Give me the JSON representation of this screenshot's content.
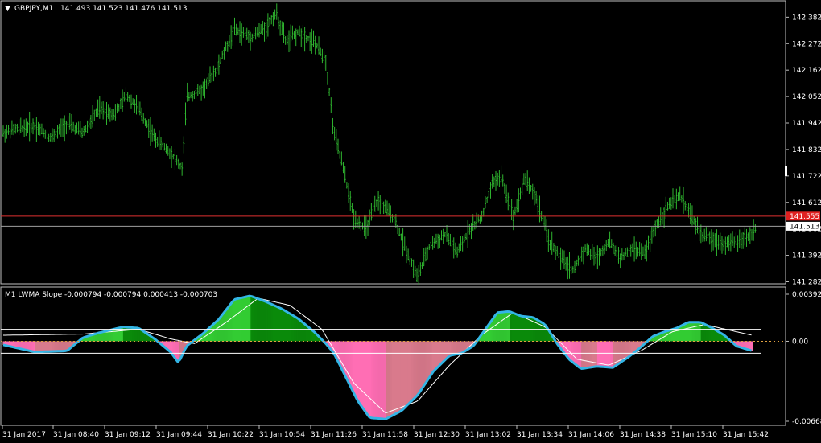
{
  "main_chart": {
    "symbol_label": "GBPJPY,M1",
    "ohlc_text": "141.493 141.523 141.476 141.513",
    "y_ticks": [
      "142.382",
      "142.272",
      "142.162",
      "142.052",
      "141.942",
      "141.832",
      "141.722",
      "141.612",
      "141.502",
      "141.392",
      "141.282"
    ],
    "price_range": [
      141.277,
      142.44
    ],
    "current_price": "141.513",
    "alert_price": "141.555",
    "colors": {
      "candle": "#2fb52f",
      "alert_line": "#e03030",
      "price_line": "#a0a0a0",
      "alert_badge": "#e02020",
      "price_badge": "#ffffff"
    }
  },
  "indicator": {
    "title": "M1 LWMA Slope",
    "values_text": "-0.000794 -0.000794 0.000413 -0.000703",
    "y_ticks": [
      "0.003929",
      "0.00",
      "-0.006689"
    ],
    "value_range": [
      -0.006689,
      0.003929
    ],
    "colors": {
      "pos_light": "#33cc33",
      "pos_dark": "#0a8a0a",
      "neg_light": "#ff6eb4",
      "neg_dark": "#d97a8c",
      "slope_line": "#33b5e5",
      "signal_line": "#ffffff",
      "zero_line": "#e0a040"
    }
  },
  "time_axis": [
    "31 Jan 2017",
    "31 Jan 08:40",
    "31 Jan 09:12",
    "31 Jan 09:44",
    "31 Jan 10:22",
    "31 Jan 10:54",
    "31 Jan 11:26",
    "31 Jan 11:58",
    "31 Jan 12:30",
    "31 Jan 13:02",
    "31 Jan 13:34",
    "31 Jan 14:06",
    "31 Jan 14:38",
    "31 Jan 15:10",
    "31 Jan 15:42"
  ],
  "chart_data": [
    {
      "type": "candlestick",
      "title": "GBPJPY,M1",
      "ylim": [
        141.277,
        142.44
      ],
      "series": [
        {
          "name": "GBPJPY,M1",
          "x": [
            0,
            20,
            40,
            60,
            80,
            100,
            120,
            140,
            155,
            170,
            190,
            210,
            225,
            230,
            250,
            270,
            290,
            310,
            330,
            342,
            355,
            370,
            390,
            405,
            415,
            425,
            440,
            455,
            470,
            490,
            505,
            520,
            535,
            555,
            570,
            585,
            600,
            615,
            625,
            640,
            655,
            670,
            685,
            700,
            715,
            730,
            745,
            760,
            775,
            790,
            805,
            820,
            835,
            850,
            860,
            875,
            890,
            905,
            920,
            935,
            945
          ],
          "y": [
            141.9,
            141.92,
            141.93,
            141.88,
            141.94,
            141.9,
            142.0,
            141.98,
            142.06,
            142.0,
            141.88,
            141.82,
            141.75,
            142.05,
            142.08,
            142.18,
            142.33,
            142.3,
            142.34,
            142.4,
            142.28,
            142.32,
            142.28,
            142.2,
            141.9,
            141.78,
            141.55,
            141.5,
            141.62,
            141.55,
            141.42,
            141.3,
            141.43,
            141.48,
            141.4,
            141.5,
            141.55,
            141.7,
            141.72,
            141.55,
            141.72,
            141.62,
            141.45,
            141.38,
            141.33,
            141.42,
            141.38,
            141.45,
            141.38,
            141.42,
            141.4,
            141.52,
            141.6,
            141.64,
            141.58,
            141.48,
            141.46,
            141.44,
            141.45,
            141.47,
            141.51
          ]
        }
      ]
    },
    {
      "type": "area",
      "title": "M1 LWMA Slope",
      "ylim": [
        -0.006689,
        0.003929
      ],
      "series": [
        {
          "name": "slope",
          "x": [
            0,
            40,
            80,
            100,
            120,
            150,
            170,
            190,
            210,
            220,
            230,
            250,
            270,
            290,
            310,
            330,
            350,
            370,
            390,
            405,
            415,
            430,
            445,
            460,
            480,
            500,
            520,
            540,
            560,
            575,
            590,
            605,
            620,
            635,
            650,
            665,
            680,
            695,
            710,
            725,
            745,
            765,
            785,
            800,
            815,
            830,
            845,
            860,
            875,
            890,
            905,
            920,
            940
          ],
          "y": [
            -0.0003,
            -0.0009,
            -0.0008,
            0.0003,
            0.0007,
            0.0012,
            0.0011,
            0.0002,
            -0.0009,
            -0.0018,
            -0.0004,
            0.0006,
            0.0018,
            0.0035,
            0.0038,
            0.0033,
            0.0027,
            0.0019,
            0.0008,
            -0.0002,
            -0.001,
            -0.003,
            -0.005,
            -0.0064,
            -0.0065,
            -0.0058,
            -0.0045,
            -0.0025,
            -0.0012,
            -0.001,
            -0.0004,
            0.001,
            0.0024,
            0.0025,
            0.0021,
            0.002,
            0.0014,
            -0.0002,
            -0.0015,
            -0.0023,
            -0.0021,
            -0.0022,
            -0.0013,
            -0.0005,
            0.0004,
            0.0008,
            0.0011,
            0.0016,
            0.0016,
            0.0011,
            0.0005,
            -0.0004,
            -0.0008
          ]
        },
        {
          "name": "signal",
          "x": [
            0,
            100,
            170,
            210,
            240,
            280,
            320,
            360,
            400,
            440,
            480,
            520,
            560,
            600,
            640,
            680,
            720,
            760,
            800,
            840,
            880,
            920,
            940
          ],
          "y": [
            0.0005,
            0.0006,
            0.001,
            0.0002,
            -0.0002,
            0.0016,
            0.0036,
            0.003,
            0.001,
            -0.0035,
            -0.006,
            -0.005,
            -0.002,
            0.0005,
            0.0024,
            0.0012,
            -0.0015,
            -0.002,
            -0.0008,
            0.0008,
            0.0014,
            0.0008,
            0.0005
          ]
        }
      ]
    }
  ]
}
